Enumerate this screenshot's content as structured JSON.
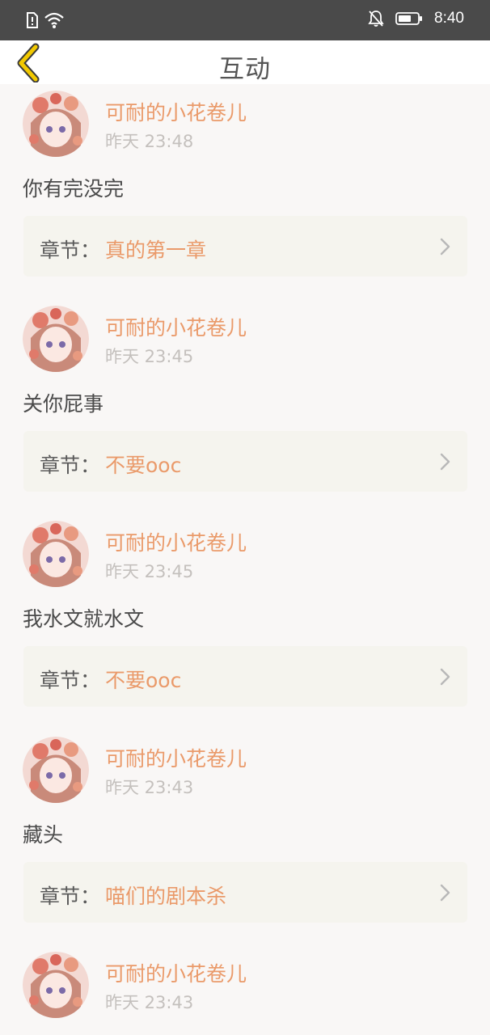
{
  "status_bar": {
    "time": "8:40",
    "icons": [
      "sim-alert-icon",
      "wifi-icon",
      "bell-muted-icon",
      "battery-icon"
    ]
  },
  "nav": {
    "title": "互动",
    "back_icon": "chevron-left-icon"
  },
  "colors": {
    "accent": "#ea9a6a",
    "back_icon": "#f2c900",
    "status_bar_bg": "#4a4a4a",
    "card_bg": "#f5f4ee"
  },
  "items": [
    {
      "user": "可耐的小花卷儿",
      "time": "昨天 23:48",
      "comment": "你有完没完",
      "chapter_label": "章节：",
      "chapter": "真的第一章"
    },
    {
      "user": "可耐的小花卷儿",
      "time": "昨天 23:45",
      "comment": "关你屁事",
      "chapter_label": "章节：",
      "chapter": "不要ooc"
    },
    {
      "user": "可耐的小花卷儿",
      "time": "昨天 23:45",
      "comment": "我水文就水文",
      "chapter_label": "章节：",
      "chapter": "不要ooc"
    },
    {
      "user": "可耐的小花卷儿",
      "time": "昨天 23:43",
      "comment": "藏头",
      "chapter_label": "章节：",
      "chapter": "喵们的剧本杀"
    },
    {
      "user": "可耐的小花卷儿",
      "time": "昨天 23:43"
    }
  ]
}
